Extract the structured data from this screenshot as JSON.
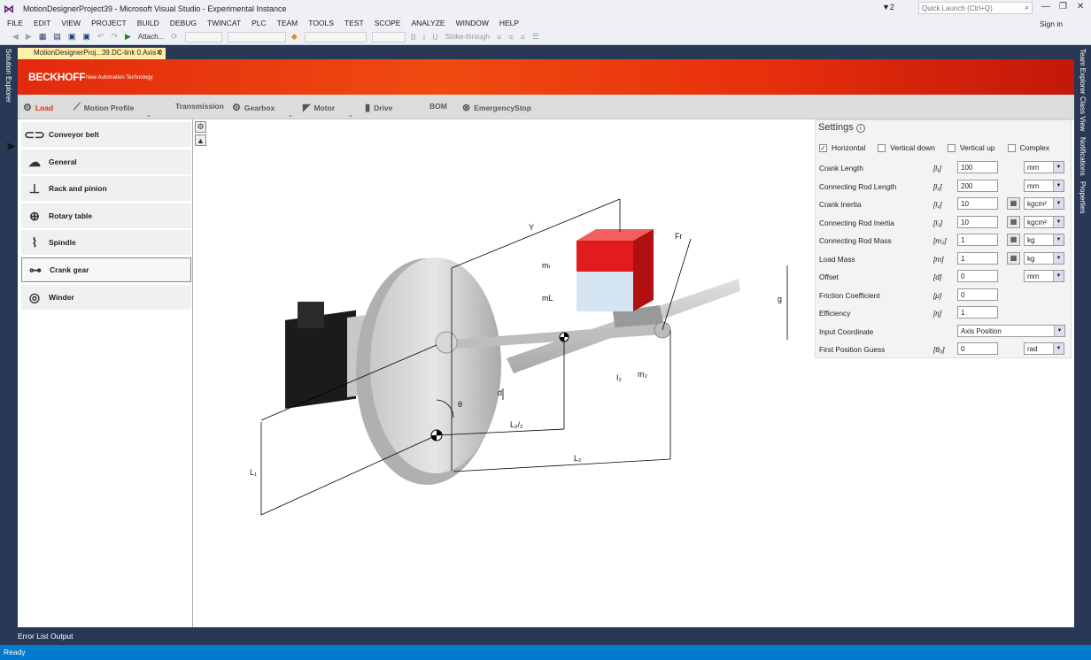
{
  "window": {
    "title": "MotionDesignerProject39 - Microsoft Visual Studio - Experimental Instance",
    "notifications_count": "2",
    "quick_launch_placeholder": "Quick Launch (Ctrl+Q)",
    "sign_in": "Sign in"
  },
  "menu": [
    "FILE",
    "EDIT",
    "VIEW",
    "PROJECT",
    "BUILD",
    "DEBUG",
    "TWINCAT",
    "PLC",
    "TEAM",
    "TOOLS",
    "TEST",
    "SCOPE",
    "ANALYZE",
    "WINDOW",
    "HELP"
  ],
  "toolbar": {
    "attach_label": "Attach...",
    "strikethrough_label": "Strike-through"
  },
  "side_tabs": {
    "left": "Solution Explorer",
    "right": [
      "Team Explorer",
      "Class View",
      "Notifications",
      "Properties"
    ]
  },
  "document_tab": {
    "label": "MotionDesignerProj...39.DC-link 0.Axis 0"
  },
  "banner": {
    "brand": "BECKHOFF",
    "tagline": "New Automation Technology"
  },
  "nav": [
    {
      "label": "Load",
      "icon": "crank-gear-icon",
      "active": true
    },
    {
      "label": "Motion Profile",
      "icon": "profile-chart-icon"
    },
    {
      "label": "Transmission",
      "icon": ""
    },
    {
      "label": "Gearbox",
      "icon": "gearbox-icon"
    },
    {
      "label": "Motor",
      "icon": "motor-icon"
    },
    {
      "label": "Drive",
      "icon": "drive-icon"
    },
    {
      "label": "BOM",
      "icon": ""
    },
    {
      "label": "EmergencyStop",
      "icon": "emergency-stop-icon"
    }
  ],
  "load_types": [
    {
      "label": "Conveyor belt",
      "icon": "conveyor-belt-icon"
    },
    {
      "label": "General",
      "icon": "general-load-icon"
    },
    {
      "label": "Rack and pinion",
      "icon": "rack-pinion-icon"
    },
    {
      "label": "Rotary table",
      "icon": "rotary-table-icon"
    },
    {
      "label": "Spindle",
      "icon": "spindle-icon"
    },
    {
      "label": "Crank gear",
      "icon": "crank-gear-icon",
      "selected": true
    },
    {
      "label": "Winder",
      "icon": "winder-icon"
    }
  ],
  "diagram": {
    "labels": {
      "y": "Y",
      "fr": "Fr",
      "mr": "mᵣ",
      "ml": "mL",
      "g": "g",
      "i2": "I₂",
      "m2": "m₂",
      "d": "d",
      "theta": "θ",
      "l2_half": "L₂/₂",
      "l2": "L₂",
      "l1": "L₁",
      "i1": "I₁"
    }
  },
  "settings": {
    "title": "Settings",
    "orientation": [
      {
        "label": "Horizontal",
        "checked": true
      },
      {
        "label": "Vertical down",
        "checked": false
      },
      {
        "label": "Vertical up",
        "checked": false
      },
      {
        "label": "Complex",
        "checked": false
      }
    ],
    "params": [
      {
        "label": "Crank Length",
        "symbol": "[l₁]",
        "value": "100",
        "unit": "mm",
        "calc": false
      },
      {
        "label": "Connecting Rod Length",
        "symbol": "[l₂]",
        "value": "200",
        "unit": "mm",
        "calc": false
      },
      {
        "label": "Crank Inertia",
        "symbol": "[I₁]",
        "value": "10",
        "unit": "kgcm²",
        "calc": true
      },
      {
        "label": "Connecting Rod Inertia",
        "symbol": "[I₂]",
        "value": "10",
        "unit": "kgcm²",
        "calc": true
      },
      {
        "label": "Connecting Rod Mass",
        "symbol": "[m₂]",
        "value": "1",
        "unit": "kg",
        "calc": true
      },
      {
        "label": "Load Mass",
        "symbol": "[m]",
        "value": "1",
        "unit": "kg",
        "calc": true
      },
      {
        "label": "Offset",
        "symbol": "[d]",
        "value": "0",
        "unit": "mm",
        "calc": false
      },
      {
        "label": "Friction Coefficient",
        "symbol": "[μ]",
        "value": "0",
        "unit": "",
        "calc": false
      },
      {
        "label": "Efficiency",
        "symbol": "[η]",
        "value": "1",
        "unit": "",
        "calc": false
      },
      {
        "label": "Input Coordinate",
        "symbol": "",
        "value": "Axis Position",
        "unit": "",
        "calc": false,
        "wide": true
      },
      {
        "label": "First Position Guess",
        "symbol": "[θ₀]",
        "value": "0",
        "unit": "rad",
        "calc": false
      }
    ]
  },
  "bottom_tabs": [
    "Error List",
    "Output"
  ],
  "status": "Ready"
}
